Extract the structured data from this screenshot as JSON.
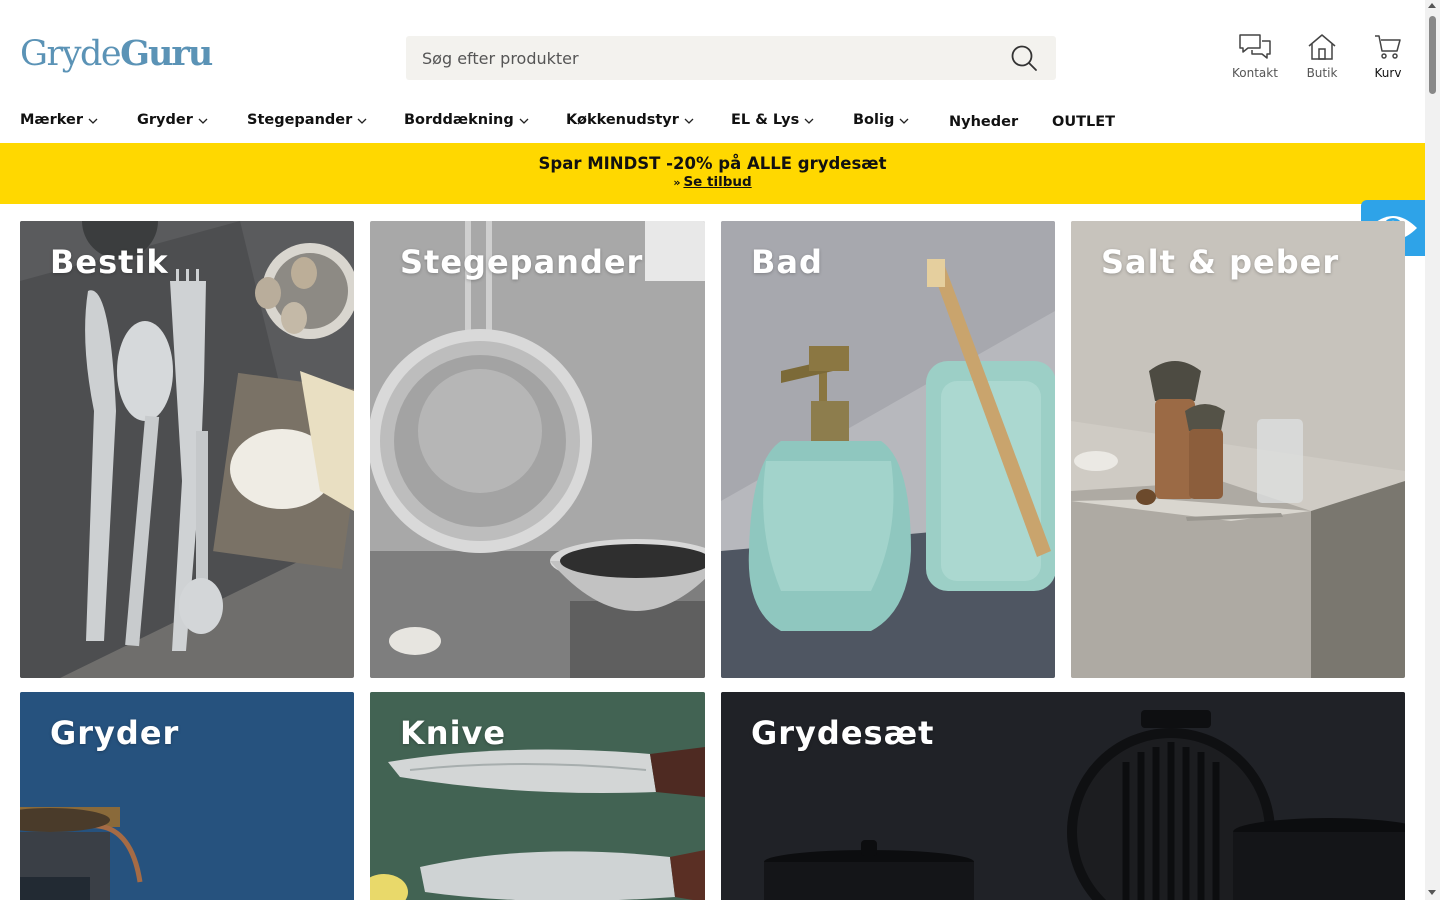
{
  "header": {
    "logo": {
      "part1": "Gryde",
      "part2": "Guru"
    },
    "search": {
      "placeholder": "Søg efter produkter"
    },
    "icons": {
      "kontakt": "Kontakt",
      "butik": "Butik",
      "kurv": "Kurv"
    }
  },
  "nav": {
    "items": [
      {
        "label": "Mærker"
      },
      {
        "label": "Gryder"
      },
      {
        "label": "Stegepander"
      },
      {
        "label": "Borddækning"
      },
      {
        "label": "Køkkenudstyr"
      },
      {
        "label": "EL & Lys"
      },
      {
        "label": "Bolig"
      },
      {
        "label": "Nyheder"
      },
      {
        "label": "OUTLET"
      }
    ]
  },
  "banner": {
    "headline": "Spar MINDST -20% på ALLE grydesæt",
    "arrow": "»",
    "cta": "Se tilbud",
    "background": "#ffd800"
  },
  "tiles": [
    {
      "title": "Bestik"
    },
    {
      "title": "Stegepander"
    },
    {
      "title": "Bad"
    },
    {
      "title": "Salt & peber"
    },
    {
      "title": "Gryder"
    },
    {
      "title": "Knive"
    },
    {
      "title": "Grydesæt"
    }
  ],
  "colors": {
    "brand": "#5b93b6",
    "banner": "#ffd800",
    "accessibility": "#2ea3e8"
  }
}
